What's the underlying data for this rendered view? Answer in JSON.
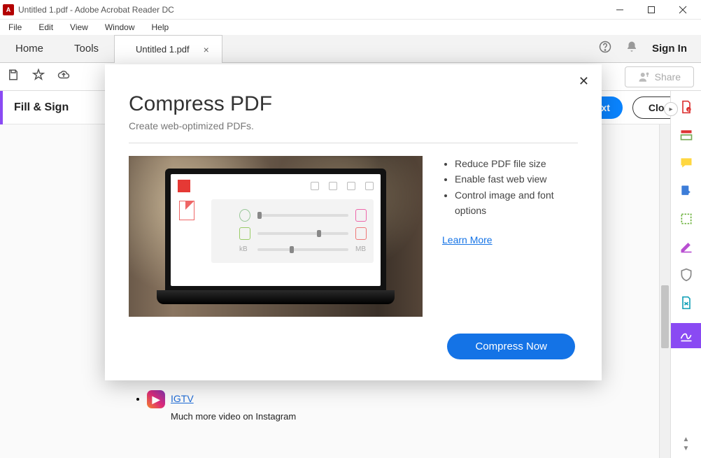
{
  "titlebar": {
    "title": "Untitled 1.pdf - Adobe Acrobat Reader DC"
  },
  "menu": {
    "file": "File",
    "edit": "Edit",
    "view": "View",
    "window": "Window",
    "help": "Help"
  },
  "tabs": {
    "home": "Home",
    "tools": "Tools",
    "doc": "Untitled 1.pdf",
    "signin": "Sign In"
  },
  "toolbar": {
    "share": "Share"
  },
  "secbar": {
    "fillsign": "Fill & Sign",
    "next": "xt",
    "close": "Close"
  },
  "doc": {
    "link": "IGTV",
    "sub": "Much more video on Instagram"
  },
  "modal": {
    "title": "Compress PDF",
    "subtitle": "Create web-optimized PDFs.",
    "bullets": [
      "Reduce PDF file size",
      "Enable fast web view",
      "Control image and font options"
    ],
    "learn": "Learn More",
    "cta": "Compress Now",
    "preview": {
      "kb": "kB",
      "mb": "MB"
    }
  }
}
